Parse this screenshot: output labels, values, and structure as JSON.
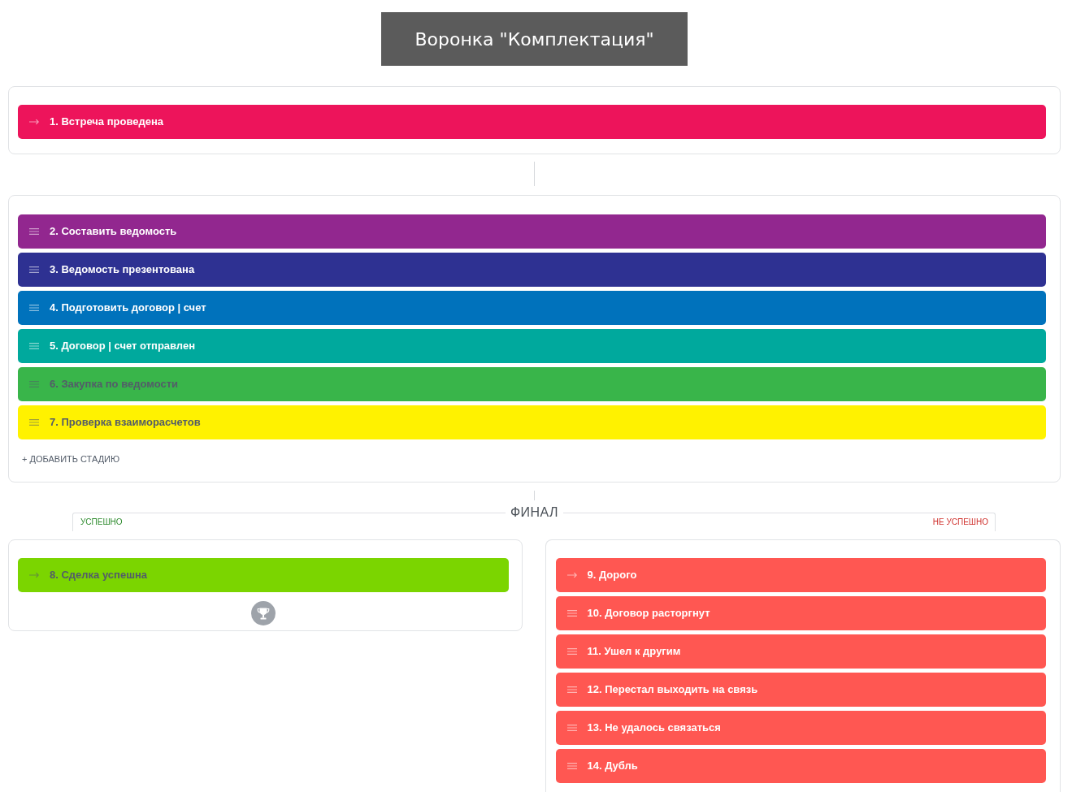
{
  "funnel_title": "Воронка \"Комплектация\"",
  "start_stages": [
    {
      "label": "1. Встреча проведена",
      "kind": "fixed",
      "color": "#ed145b"
    }
  ],
  "work_stages": [
    {
      "label": "2. Составить ведомость",
      "kind": "sortable",
      "color": "#92278f"
    },
    {
      "label": "3. Ведомость презентована",
      "kind": "sortable",
      "color": "#2e3192"
    },
    {
      "label": "4. Подготовить договор | счет",
      "kind": "sortable",
      "color": "#0072bc"
    },
    {
      "label": "5. Договор | счет отправлен",
      "kind": "sortable",
      "color": "#00a99d"
    },
    {
      "label": "6. Закупка по ведомости",
      "kind": "sortable",
      "color": "#39b54a"
    },
    {
      "label": "7. Проверка взаиморасчетов",
      "kind": "sortable",
      "color": "#fff200"
    }
  ],
  "add_stage_link": "+ ДОБАВИТЬ СТАДИЮ",
  "final": {
    "title": "ФИНАЛ",
    "success": {
      "label": "УСПЕШНО",
      "stages": [
        {
          "label": "8. Сделка успешна",
          "kind": "fixed",
          "color": "#7bd500"
        }
      ]
    },
    "failure": {
      "label": "НЕ УСПЕШНО",
      "stages": [
        {
          "label": "9. Дорого",
          "kind": "fixed",
          "color": "#ff5752"
        },
        {
          "label": "10. Договор расторгнут",
          "kind": "sortable",
          "color": "#ff5752"
        },
        {
          "label": "11. Ушел к другим",
          "kind": "sortable",
          "color": "#ff5752"
        },
        {
          "label": "12. Перестал выходить на связь",
          "kind": "sortable",
          "color": "#ff5752"
        },
        {
          "label": "13. Не удалось связаться",
          "kind": "sortable",
          "color": "#ff5752"
        },
        {
          "label": "14. Дубль",
          "kind": "sortable",
          "color": "#ff5752"
        }
      ]
    }
  }
}
